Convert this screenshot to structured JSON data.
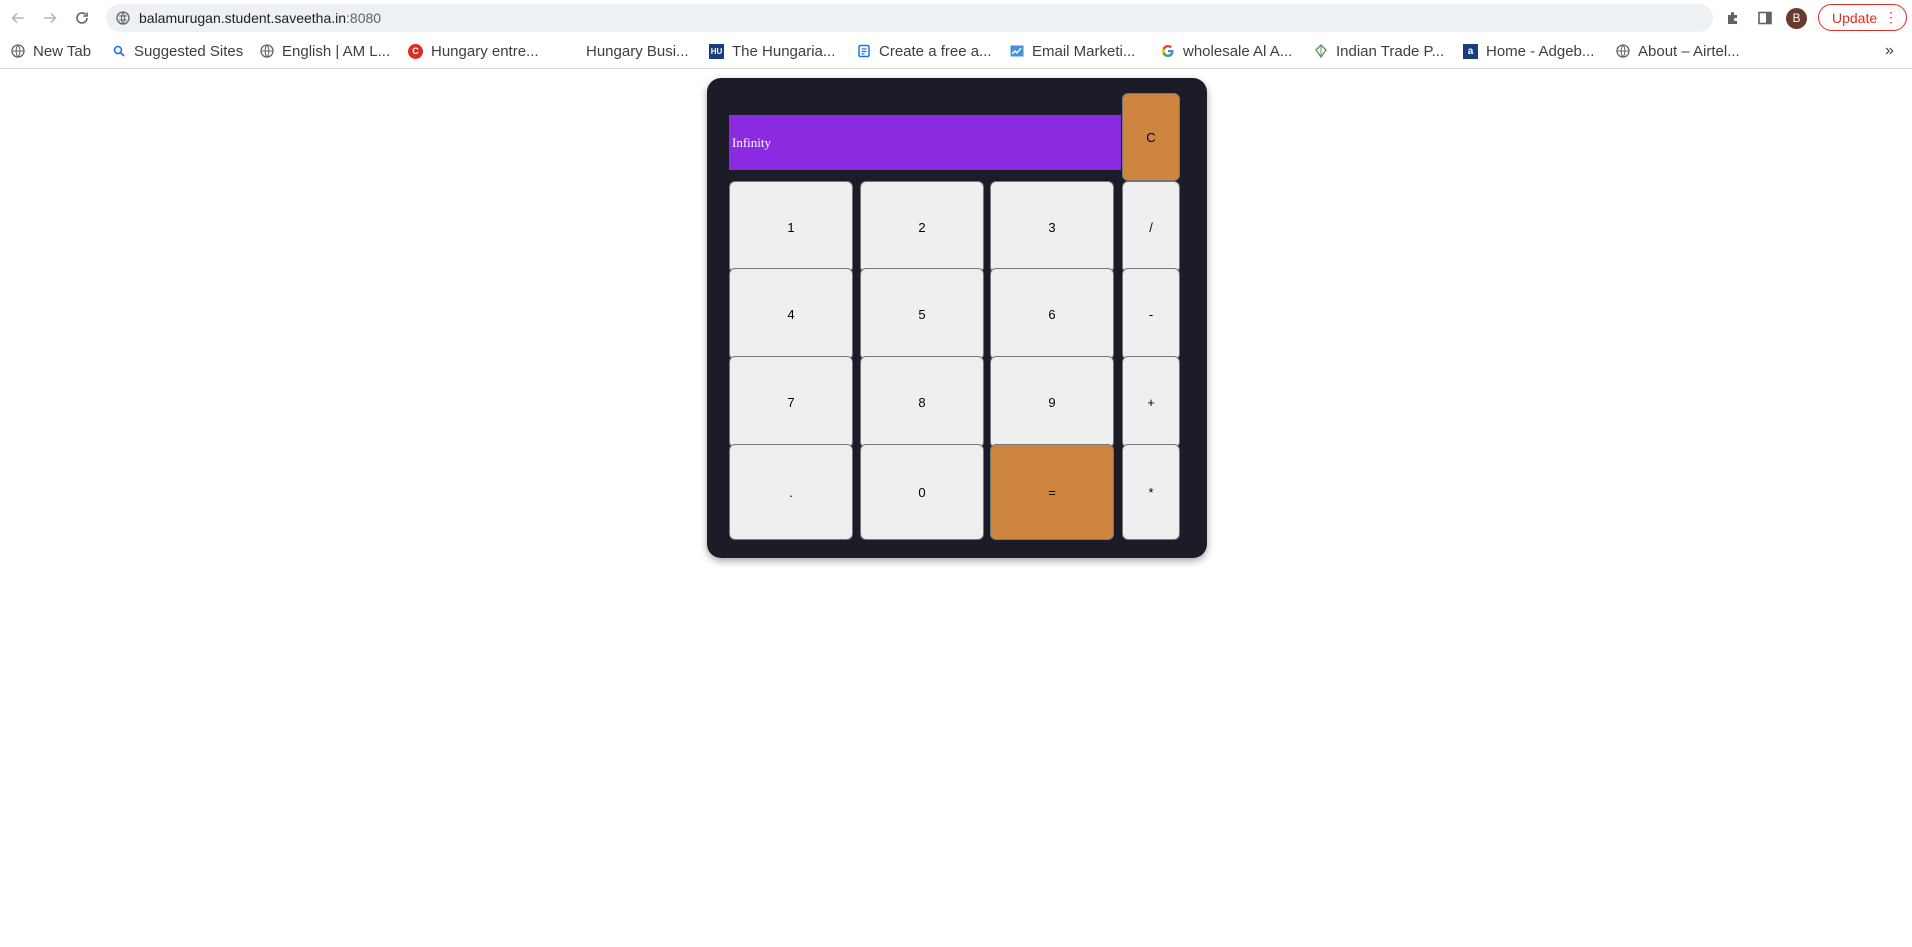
{
  "browser": {
    "url_host": "balamurugan.student.saveetha.in",
    "url_port": ":8080",
    "profile_initial": "B",
    "update_label": "Update",
    "accent_color": "#d93025"
  },
  "bookmarks": [
    {
      "label": "New Tab",
      "icon": "globe-icon"
    },
    {
      "label": "Suggested Sites",
      "icon": "search-icon"
    },
    {
      "label": "English | AM L...",
      "icon": "globe-icon"
    },
    {
      "label": "Hungary entre...",
      "icon": "red-c-logo-icon"
    },
    {
      "label": "Hungary Busi...",
      "icon": "blank-icon"
    },
    {
      "label": "The Hungaria...",
      "icon": "hu-logo-icon"
    },
    {
      "label": "Create a free a...",
      "icon": "document-icon"
    },
    {
      "label": "Email Marketi...",
      "icon": "chart-icon"
    },
    {
      "label": "wholesale Al A...",
      "icon": "google-icon"
    },
    {
      "label": "Indian Trade P...",
      "icon": "leaf-icon"
    },
    {
      "label": "Home - Adgeb...",
      "icon": "a-logo-icon"
    },
    {
      "label": "About – Airtel...",
      "icon": "globe-icon"
    }
  ],
  "calculator": {
    "display": "Infinity",
    "clear": "C",
    "row1": [
      "1",
      "2",
      "3",
      "/"
    ],
    "row2": [
      "4",
      "5",
      "6",
      "-"
    ],
    "row3": [
      "7",
      "8",
      "9",
      "+"
    ],
    "row4": [
      ".",
      "0",
      "=",
      "*"
    ],
    "colors": {
      "body": "#1b1c28",
      "display": "#8a2be2",
      "accent": "#cd853f",
      "key": "#efefef"
    }
  }
}
